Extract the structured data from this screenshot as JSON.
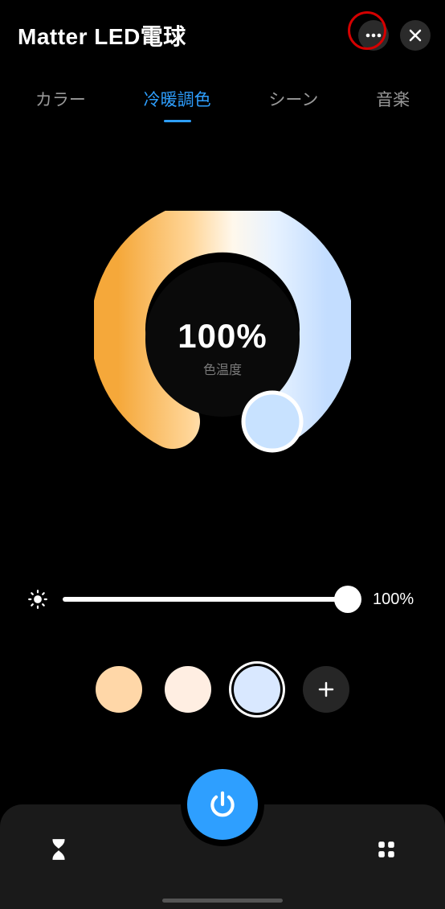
{
  "header": {
    "title": "Matter LED電球"
  },
  "tabs": [
    {
      "label": "カラー",
      "active": false
    },
    {
      "label": "冷暖調色",
      "active": true
    },
    {
      "label": "シーン",
      "active": false
    },
    {
      "label": "音楽",
      "active": false
    }
  ],
  "dial": {
    "percent": "100%",
    "label": "色温度"
  },
  "brightness": {
    "value_label": "100%",
    "value_pct": 100
  },
  "presets": [
    {
      "color": "#ffd7a8",
      "selected": false
    },
    {
      "color": "#ffeee2",
      "selected": false
    },
    {
      "color": "#d9e8ff",
      "selected": true
    }
  ],
  "icons": {
    "more": "more-icon",
    "close": "close-icon",
    "brightness": "brightness-icon",
    "add": "plus-icon",
    "power": "power-icon",
    "timer": "hourglass-icon",
    "more_apps": "grid-icon"
  }
}
